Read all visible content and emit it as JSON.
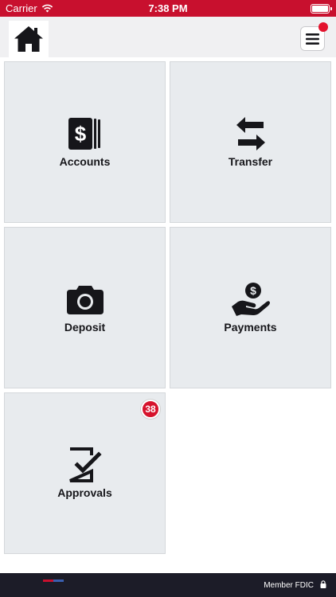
{
  "status_bar": {
    "carrier": "Carrier",
    "time": "7:38 PM"
  },
  "header": {
    "notification_color": "#e3122d"
  },
  "tiles": [
    {
      "label": "Accounts",
      "icon": "accounts-dollar-icon"
    },
    {
      "label": "Transfer",
      "icon": "transfer-arrows-icon"
    },
    {
      "label": "Deposit",
      "icon": "camera-icon"
    },
    {
      "label": "Payments",
      "icon": "payment-hand-icon"
    },
    {
      "label": "Approvals",
      "icon": "approvals-check-icon",
      "badge": "38"
    }
  ],
  "footer": {
    "member_text": "Member FDIC"
  },
  "colors": {
    "brand_red": "#c8102e",
    "tile_bg": "#e8ebee",
    "footer_bg": "#1c1c28"
  }
}
